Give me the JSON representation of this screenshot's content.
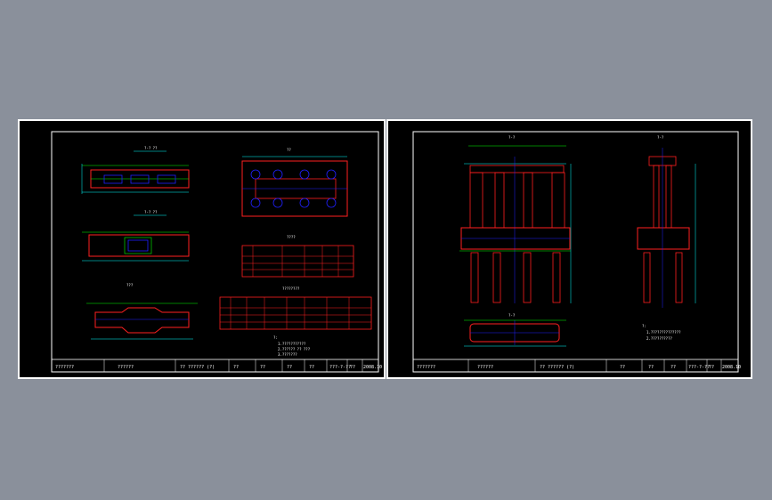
{
  "colors": {
    "background": "#8a909b",
    "sheet": "#000000",
    "frame": "#ffffff",
    "concrete": "#ff2020",
    "rebar": "#00ff00",
    "dimension": "#00ffff",
    "hole": "#2020ff",
    "axis": "#0000ff"
  },
  "left_sheet": {
    "views": {
      "plan_top": "?-? ??",
      "plan_mid": "?-? ??",
      "front": "???",
      "hole_plan": "??",
      "table1_title": "????",
      "table2_title": "????????"
    },
    "title_block": {
      "project": "???????",
      "drawing": "??????",
      "title": "?? ?????? (?)",
      "c1": "??",
      "c2": "??",
      "c3": "??",
      "c4": "??",
      "sheet_no": "???-?-??",
      "scale": "??",
      "date": "2008.10"
    },
    "notes": [
      "?:",
      "1.???????????",
      "2.?????? ?? ???",
      "3.???????"
    ]
  },
  "right_sheet": {
    "views": {
      "elevation": "?-?",
      "side": "?-?",
      "plan": "?-?"
    },
    "title_block": {
      "project": "???????",
      "drawing": "??????",
      "title": "?? ?????? (?)",
      "c1": "??",
      "c2": "??",
      "c3": "??",
      "sheet_no": "???-?-??",
      "scale": "??",
      "date": "2008.10"
    },
    "notes": [
      "?:",
      "1.??????????????",
      "2.??????????"
    ]
  }
}
